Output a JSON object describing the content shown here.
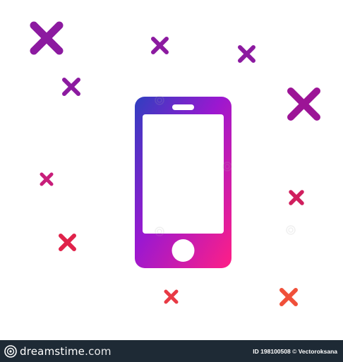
{
  "image": {
    "subject": "mobile-phone-icon",
    "gradient": {
      "top": "#3a3fc0",
      "middle": "#9b15c9",
      "bottom": "#ff1a8a"
    },
    "decor_colors": {
      "purple": "#8c1aa0",
      "magenta": "#c81e7a",
      "crimson": "#e0224a",
      "orange": "#f0503a"
    }
  },
  "footer": {
    "brand": "dreamstime",
    "brand_suffix": ".com",
    "id_label": "ID",
    "id_value": "198100508",
    "copyright_symbol": "©",
    "author": "Vectoroksana"
  }
}
